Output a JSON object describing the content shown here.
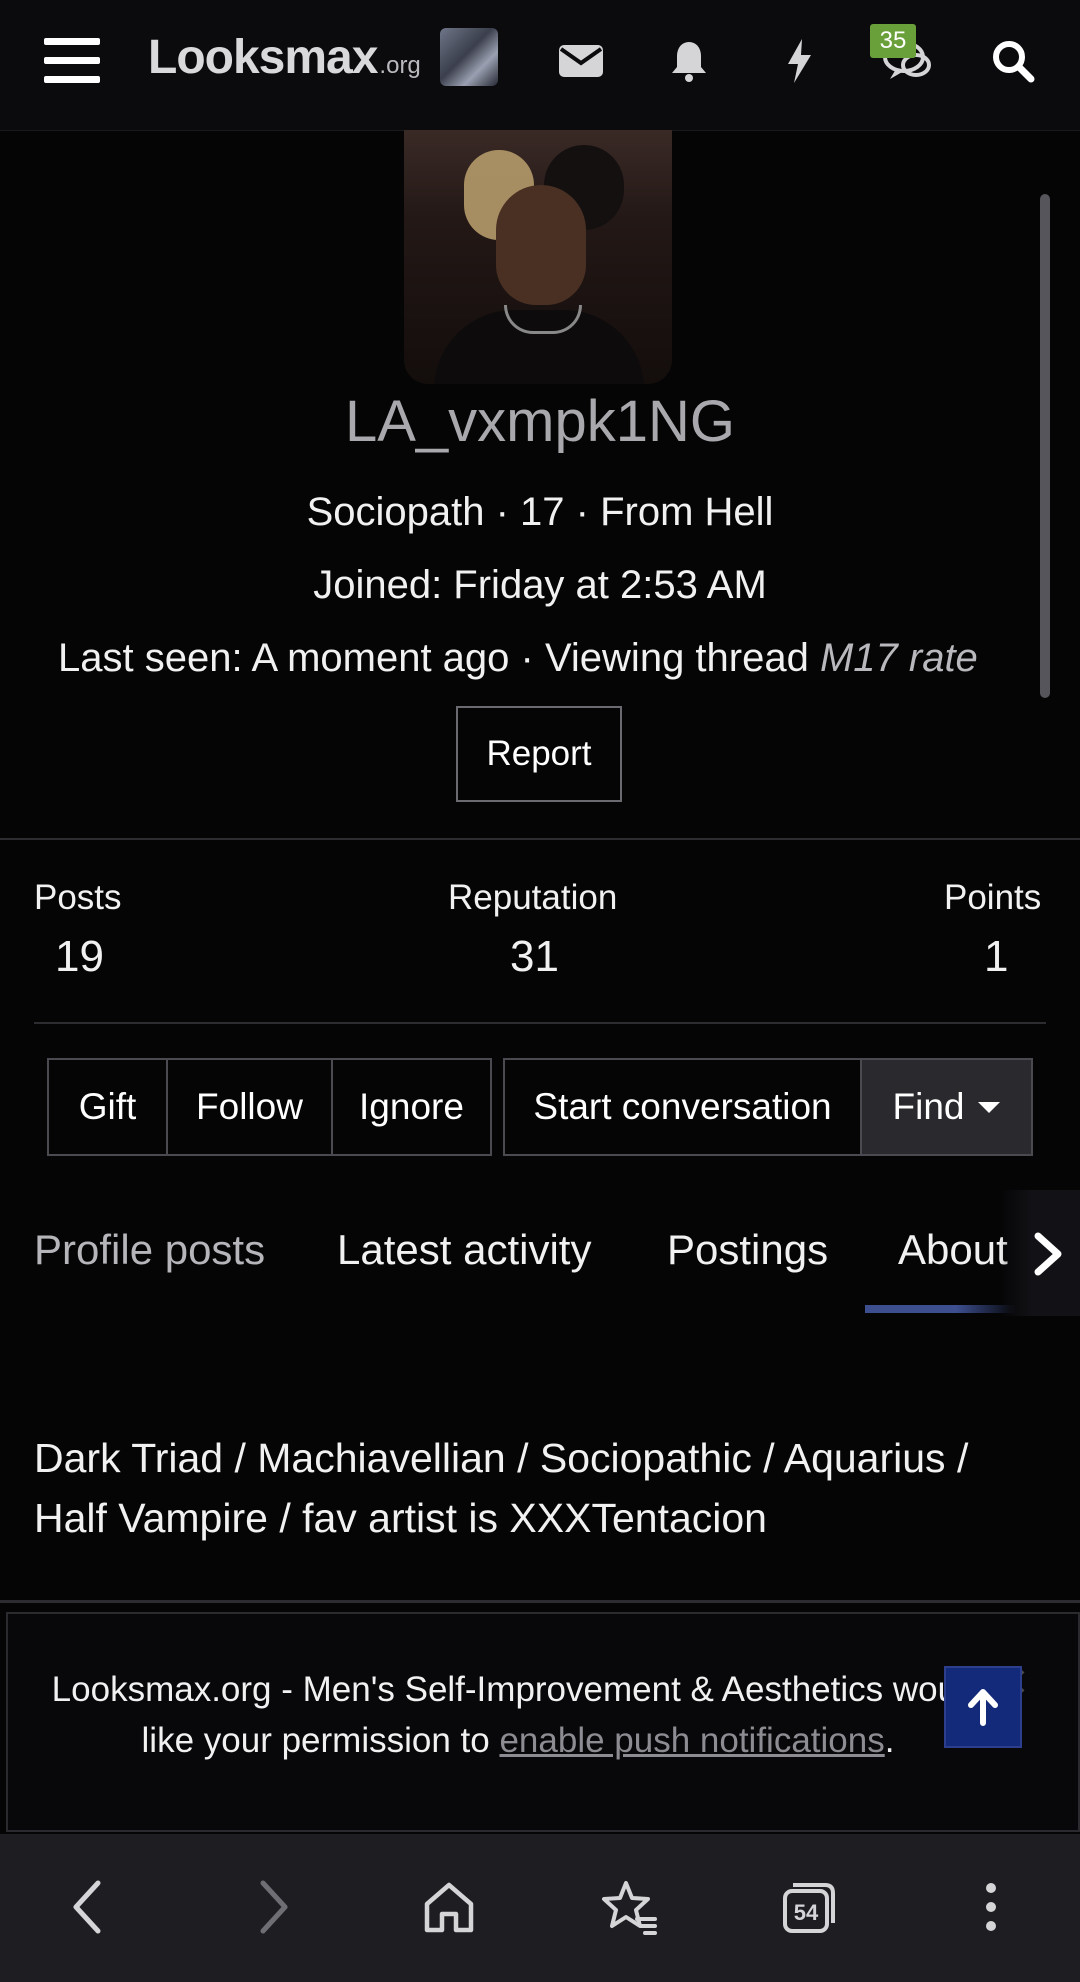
{
  "header": {
    "logo_main": "Looksmax",
    "logo_sub": ".org",
    "alerts_badge": "35"
  },
  "profile": {
    "username": "LA_vxmpk1NG",
    "info_line": "Sociopath · 17 · From Hell",
    "joined": "Joined: Friday at 2:53 AM",
    "last_seen_prefix": "Last seen: A moment ago · Viewing thread ",
    "last_seen_thread": "M17 rate",
    "report_label": "Report"
  },
  "stats": {
    "posts_label": "Posts",
    "posts_value": "19",
    "reputation_label": "Reputation",
    "reputation_value": "31",
    "points_label": "Points",
    "points_value": "1"
  },
  "actions": {
    "gift": "Gift",
    "follow": "Follow",
    "ignore": "Ignore",
    "start_conversation": "Start conversation",
    "find": "Find"
  },
  "tabs": [
    "Profile posts",
    "Latest activity",
    "Postings",
    "About"
  ],
  "about_text": "Dark Triad / Machiavellian / Sociopathic / Aquarius / Half Vampire / fav artist is XXXTentacion",
  "notice": {
    "text_before": "Looksmax.org - Men's Self-Improvement & Aesthetics would like your permission to ",
    "link": "enable push notifications",
    "text_after": "."
  },
  "browser": {
    "tab_count": "54"
  },
  "colors": {
    "background": "#050506",
    "badge": "#6aa03a",
    "accent": "#3d4f8f",
    "scroll_top": "#132a7a"
  },
  "icons": [
    "menu-icon",
    "mail-icon",
    "bell-icon",
    "bolt-icon",
    "chat-icon",
    "search-icon",
    "chevron-right-icon",
    "arrow-up-icon",
    "back-icon",
    "forward-icon",
    "home-icon",
    "bookmark-star-icon",
    "tabs-icon",
    "more-icon"
  ]
}
